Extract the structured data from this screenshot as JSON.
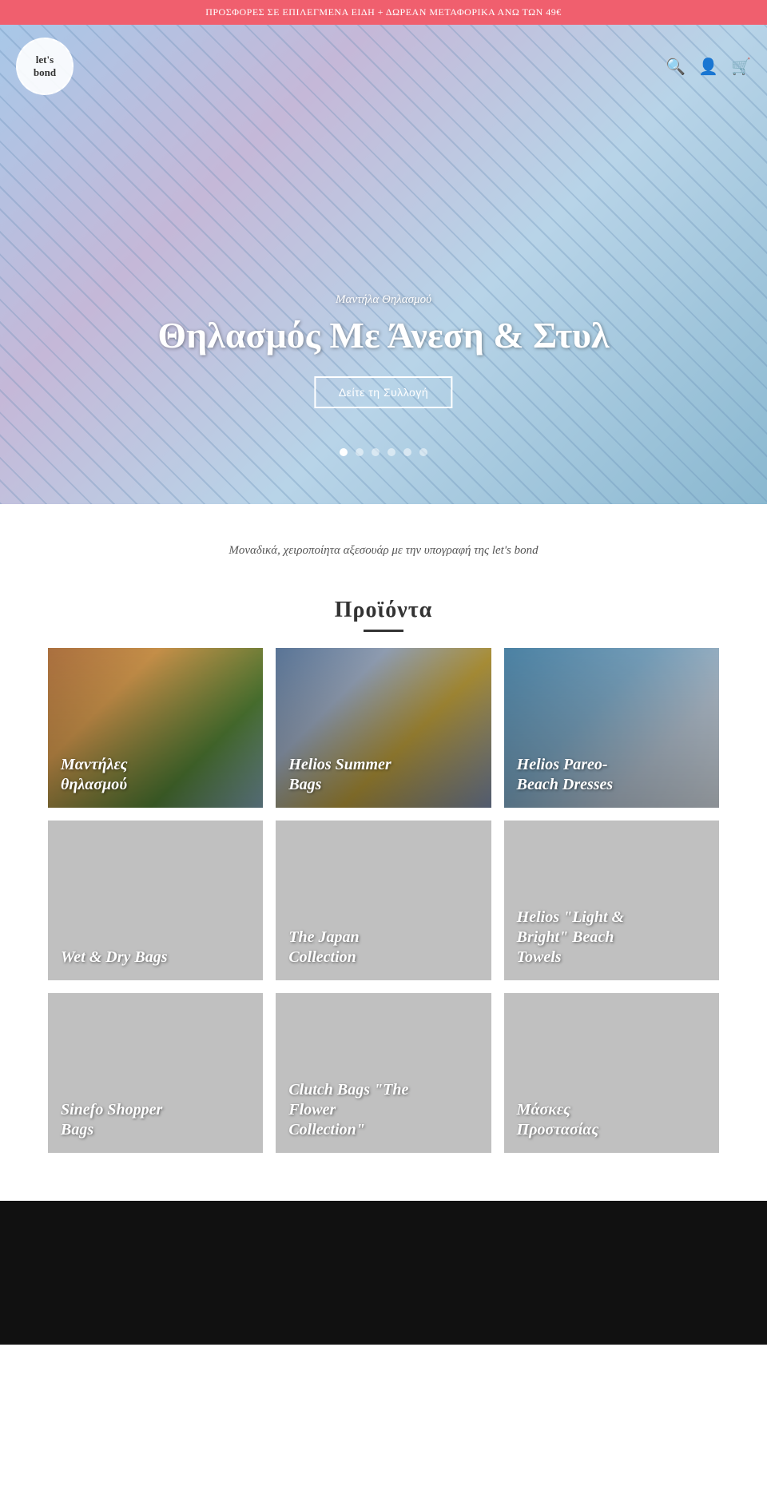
{
  "announcement": {
    "text": "ΠΡΟΣΦΟΡΕΣ ΣΕ ΕΠΙΛΕΓΜΕΝΑ ΕΙΔΗ + ΔΩΡΕΑΝ ΜΕΤΑΦΟΡΙΚΑ ΑΝΩ ΤΩΝ 49€"
  },
  "logo": {
    "line1": "let's",
    "line2": "bond"
  },
  "hero": {
    "subtitle": "Μαντήλα Θηλασμού",
    "title": "Θηλασμός Με Άνεση & Στυλ",
    "button": "Δείτε τη Συλλογή",
    "dots": [
      1,
      2,
      3,
      4,
      5,
      6
    ],
    "active_dot": 1
  },
  "tagline": {
    "text": "Μοναδικά, χειροποίητα αξεσουάρ με την υπογραφή της let's bond"
  },
  "products_section": {
    "title": "Προϊόντα",
    "items": [
      {
        "id": 1,
        "label": "Μαντήλες θηλασμού",
        "style": "photo-1"
      },
      {
        "id": 2,
        "label": "Helios Summer Bags",
        "style": "photo-2"
      },
      {
        "id": 3,
        "label": "Helios Pareo-Beach Dresses",
        "style": "photo-3"
      },
      {
        "id": 4,
        "label": "Wet & Dry Bags",
        "style": "grey"
      },
      {
        "id": 5,
        "label": "The Japan Collection",
        "style": "grey"
      },
      {
        "id": 6,
        "label": "Helios \"Light & Bright\" Beach Towels",
        "style": "grey"
      },
      {
        "id": 7,
        "label": "Sinefo Shopper Bags",
        "style": "grey"
      },
      {
        "id": 8,
        "label": "Clutch Bags \"The Flower Collection\"",
        "style": "grey"
      },
      {
        "id": 9,
        "label": "Μάσκες Προστασίας",
        "style": "grey"
      }
    ]
  }
}
